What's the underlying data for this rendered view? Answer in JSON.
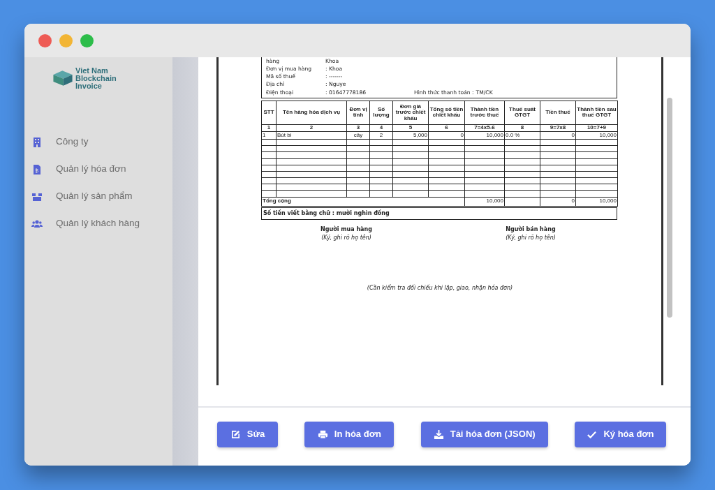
{
  "sidebar": {
    "logo_lines": [
      "Viet Nam",
      "Blockchain",
      "Invoice"
    ],
    "items": [
      {
        "label": "Công ty"
      },
      {
        "label": "Quản lý hóa đơn"
      },
      {
        "label": "Quản lý sản phẩm"
      },
      {
        "label": "Quản lý khách hàng"
      }
    ]
  },
  "invoice": {
    "buyer_info": [
      {
        "label": "hàng",
        "value": "Khoa"
      },
      {
        "label": "Đơn vị mua hàng",
        "value": ": Khoa"
      },
      {
        "label": "Mã số thuế",
        "value": ": -------"
      },
      {
        "label": "Địa chỉ",
        "value": ": Nguye"
      },
      {
        "label": "Điện thoại",
        "value": ": 01647778186"
      }
    ],
    "payment": {
      "label": "Hình thức thanh toán :",
      "value": "TM/CK"
    },
    "table": {
      "columns": [
        "STT",
        "Tên hàng hóa dịch vụ",
        "Đơn vị tính",
        "Số lượng",
        "Đơn giá trước chiết khấu",
        "Tổng số tiền chiết khấu",
        "Thành tiền trước thuế",
        "Thuế suất GTGT",
        "Tiền thuế",
        "Thành tiền sau thuế GTGT"
      ],
      "index_row": [
        "1",
        "2",
        "3",
        "4",
        "5",
        "6",
        "7=4x5-6",
        "8",
        "9=7x8",
        "10=7+9"
      ],
      "rows": [
        [
          "1",
          "Bút bi",
          "cây",
          "2",
          "5,000",
          "0",
          "10,000",
          "0.0 %",
          "0",
          "10,000"
        ]
      ],
      "total": {
        "label": "Tổng cộng",
        "pre_tax": "10,000",
        "tax": "0",
        "after_tax": "10,000"
      },
      "amount_in_words": "Số tiền viết bằng chữ : mười nghìn đồng"
    },
    "signatures": [
      {
        "title": "Người mua hàng",
        "hint": "(Ký, ghi rõ họ tên)"
      },
      {
        "title": "Người bán hàng",
        "hint": "(Ký, ghi rõ họ tên)"
      }
    ],
    "note": "(Cần kiểm tra đối chiếu khi lập, giao, nhận hóa đơn)"
  },
  "buttons": [
    {
      "label": "Sửa"
    },
    {
      "label": "In hóa đơn"
    },
    {
      "label": "Tải hóa đơn (JSON)"
    },
    {
      "label": "Ký hóa đơn"
    }
  ]
}
